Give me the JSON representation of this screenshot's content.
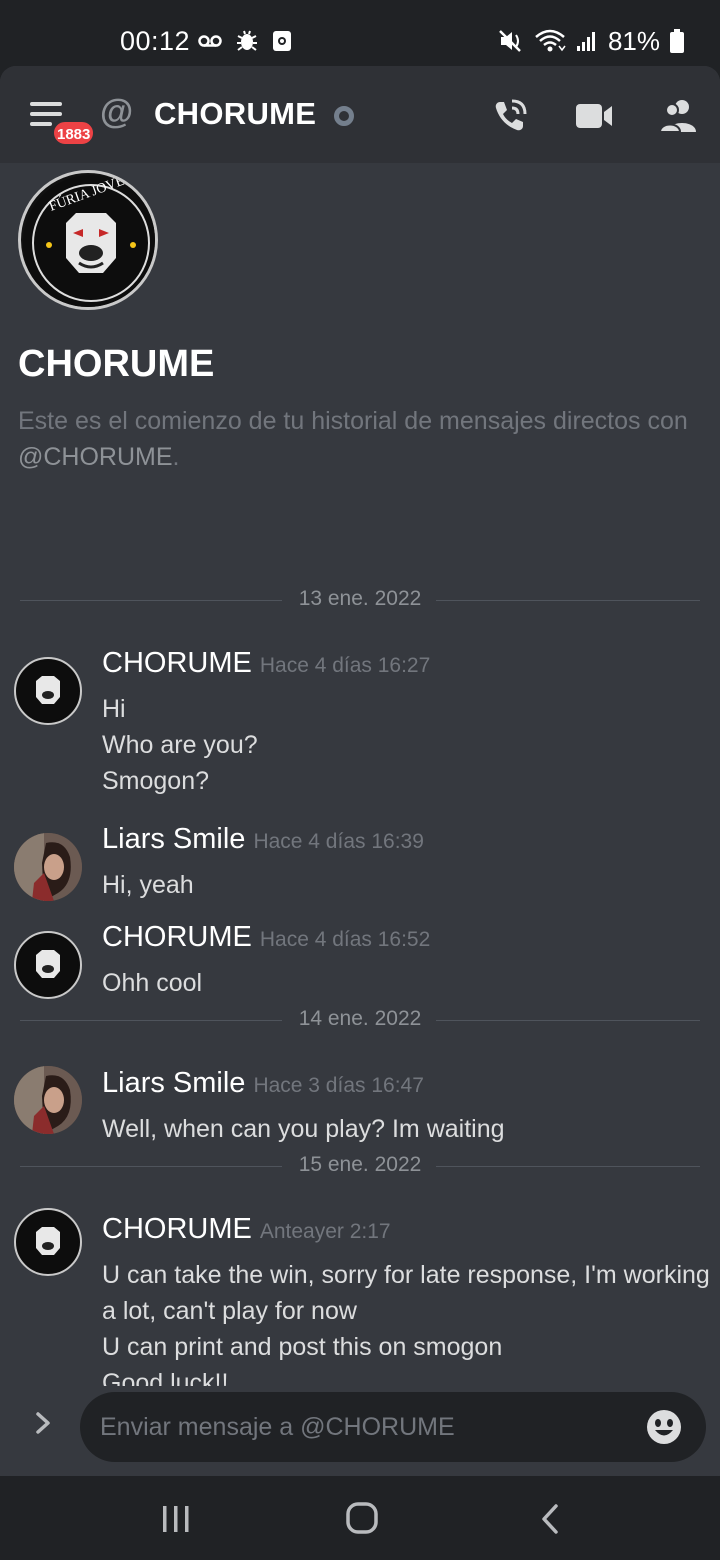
{
  "status_bar": {
    "time": "00:12",
    "battery": "81%",
    "icons": [
      "voicemail-icon",
      "bug-icon",
      "screenshot-icon",
      "mute-icon",
      "wifi-icon",
      "signal-icon",
      "battery-icon"
    ]
  },
  "header": {
    "badge": "1883",
    "channel_prefix": "@",
    "title": "CHORUME",
    "status": "offline",
    "icons": [
      "menu-icon",
      "phone-call-icon",
      "video-camera-icon",
      "members-icon"
    ]
  },
  "intro": {
    "title": "CHORUME",
    "text": "Este es el comienzo de tu historial de mensajes directos con ",
    "handle": "@CHORUME",
    "suffix": "."
  },
  "dividers": [
    "13 ene. 2022",
    "14 ene. 2022",
    "15 ene. 2022"
  ],
  "messages": [
    {
      "author": "CHORUME",
      "timestamp": "Hace 4 días 16:27",
      "lines": [
        "Hi",
        "Who are you?",
        "Smogon?"
      ]
    },
    {
      "author": "Liars Smile",
      "timestamp": "Hace 4 días 16:39",
      "lines": [
        "Hi, yeah"
      ]
    },
    {
      "author": "CHORUME",
      "timestamp": "Hace 4 días 16:52",
      "lines": [
        "Ohh cool"
      ]
    },
    {
      "author": "Liars Smile",
      "timestamp": "Hace 3 días 16:47",
      "lines": [
        "Well, when can you play? Im waiting"
      ]
    },
    {
      "author": "CHORUME",
      "timestamp": "Anteayer 2:17",
      "lines": [
        "U can take the win, sorry for late response, I'm working",
        "a lot, can't play for now",
        "U can print and post this on smogon",
        "Good luck!!"
      ]
    }
  ],
  "input": {
    "placeholder": "Enviar mensaje a @CHORUME"
  },
  "colors": {
    "background": "#36393f",
    "header": "#2f3136",
    "status_bar": "#202225",
    "badge": "#ed4245",
    "offline": "#747f8d"
  }
}
